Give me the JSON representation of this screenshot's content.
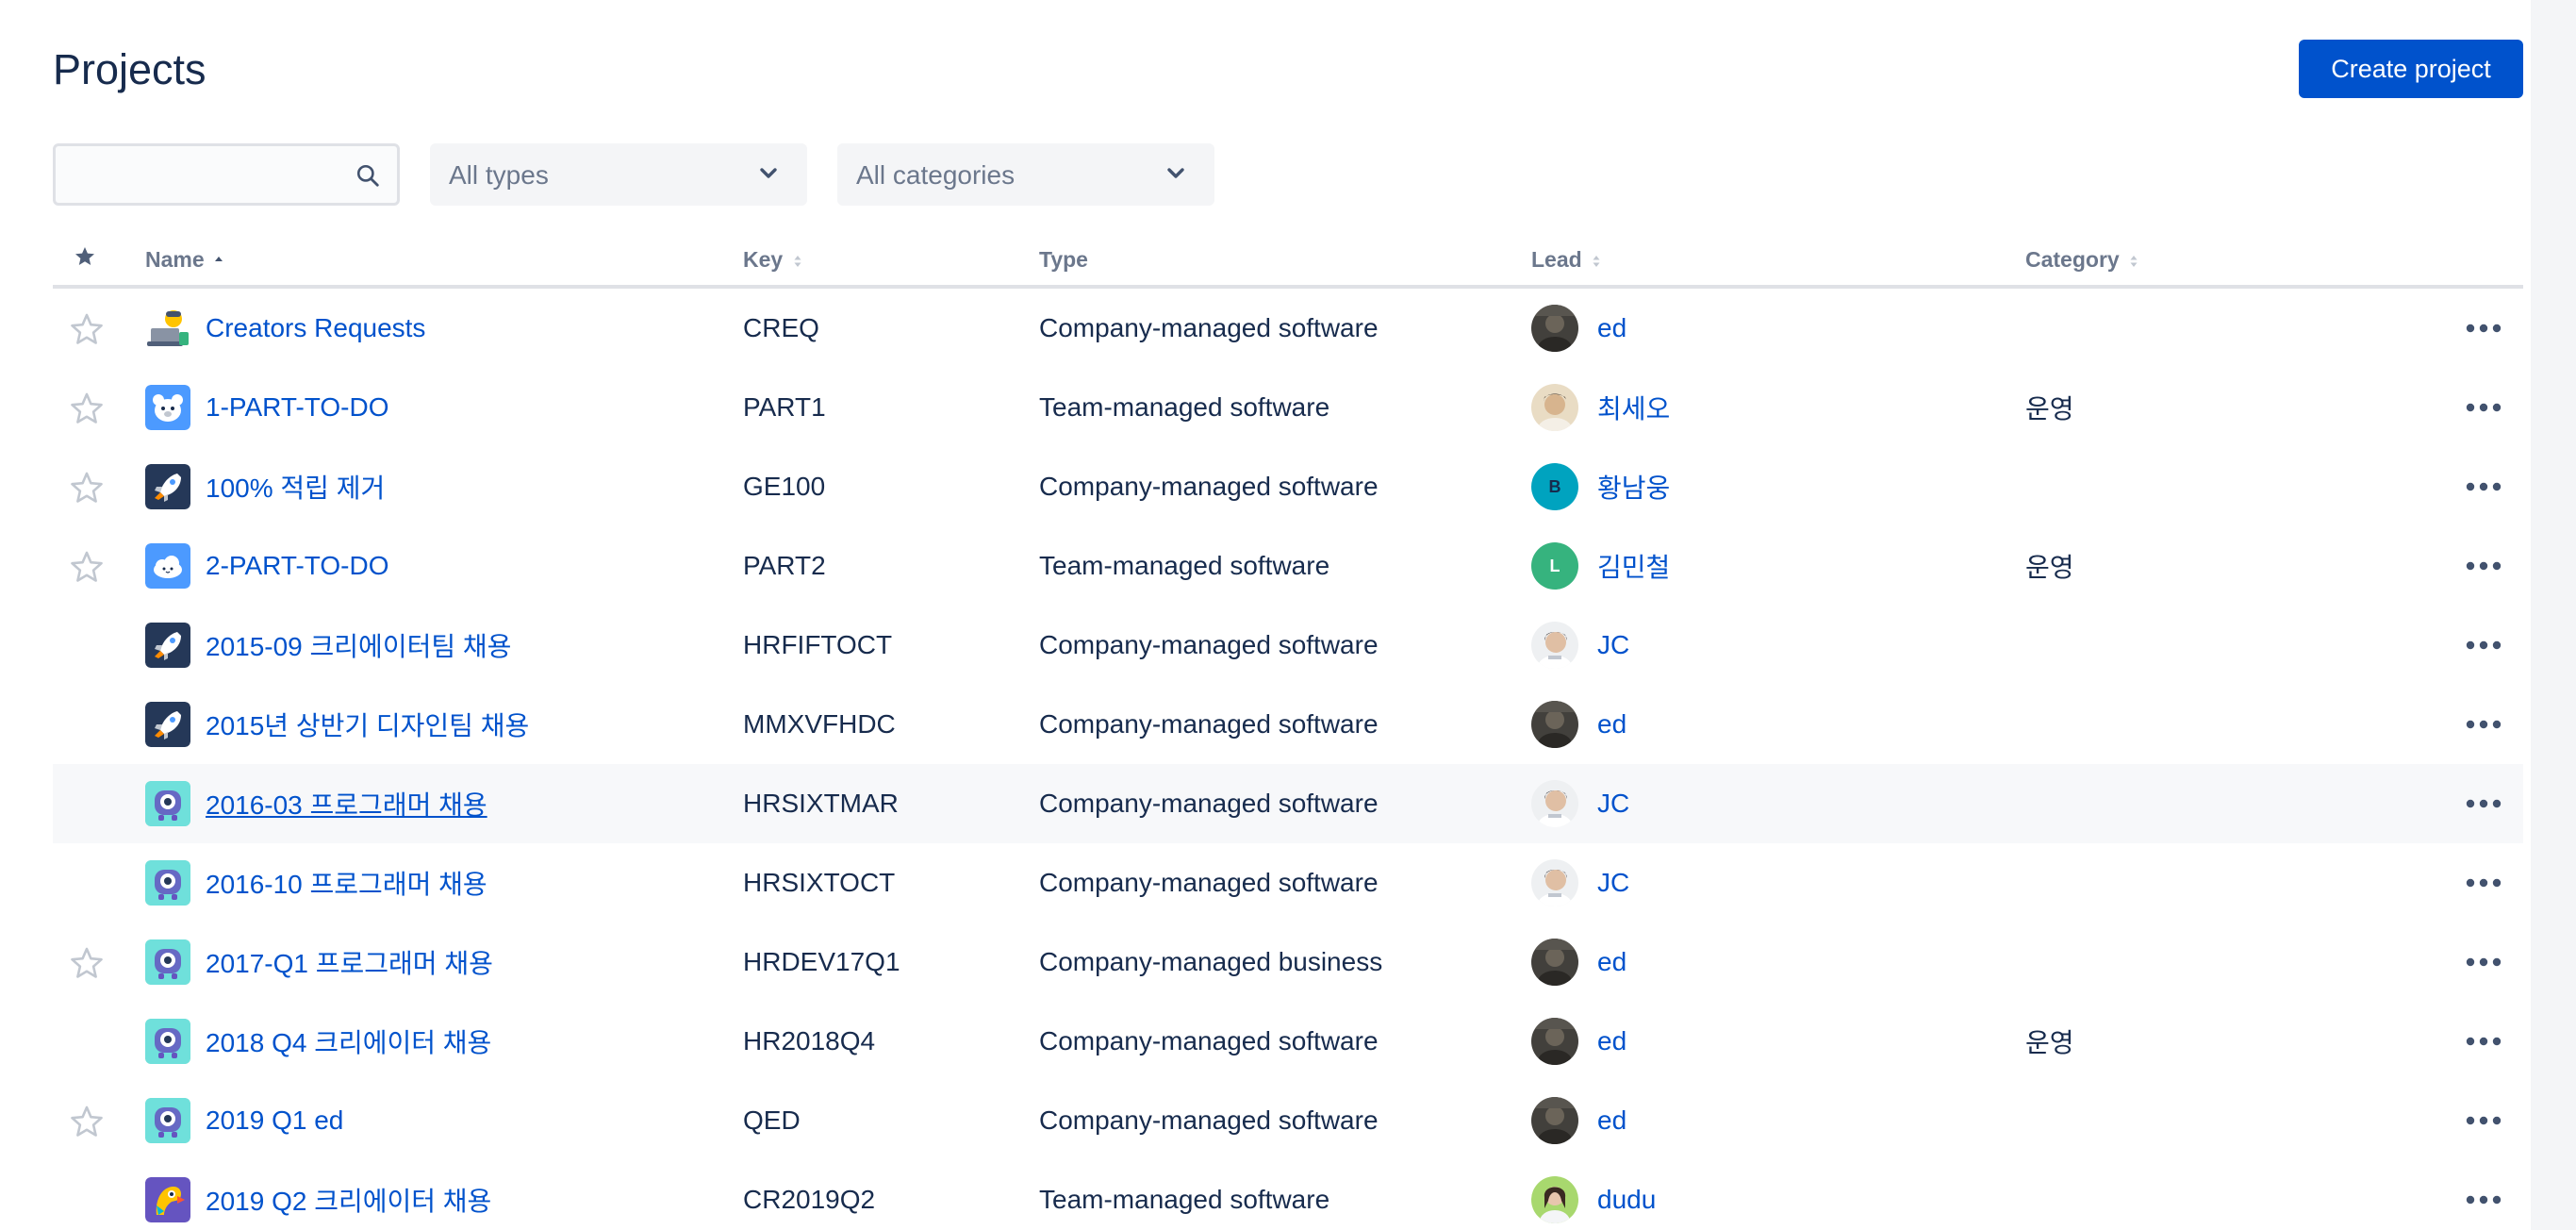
{
  "header": {
    "title": "Projects",
    "create_label": "Create project"
  },
  "filters": {
    "search_placeholder": "",
    "types_label": "All types",
    "categories_label": "All categories"
  },
  "columns": {
    "name": "Name",
    "key": "Key",
    "type": "Type",
    "lead": "Lead",
    "category": "Category"
  },
  "rows": [
    {
      "name": "Creators Requests",
      "key": "CREQ",
      "type": "Company-managed software",
      "lead": "ed",
      "category": "",
      "starred": false,
      "show_star": true,
      "icon": "laptop-icon",
      "avatar": "photo-dark"
    },
    {
      "name": "1-PART-TO-DO",
      "key": "PART1",
      "type": "Team-managed software",
      "lead": "최세오",
      "category": "운영",
      "starred": false,
      "show_star": true,
      "icon": "bear-icon",
      "avatar": "photo-light"
    },
    {
      "name": "100% 적립 제거",
      "key": "GE100",
      "type": "Company-managed software",
      "lead": "황남웅",
      "category": "",
      "starred": false,
      "show_star": true,
      "icon": "rocket-icon",
      "avatar": "initial-b",
      "avatar_initial": "B"
    },
    {
      "name": "2-PART-TO-DO",
      "key": "PART2",
      "type": "Team-managed software",
      "lead": "김민철",
      "category": "운영",
      "starred": false,
      "show_star": true,
      "icon": "cloud-icon",
      "avatar": "initial-l",
      "avatar_initial": "L"
    },
    {
      "name": "2015-09 크리에이터팀 채용",
      "key": "HRFIFTOCT",
      "type": "Company-managed software",
      "lead": "JC",
      "category": "",
      "starred": false,
      "show_star": false,
      "icon": "rocket-icon",
      "avatar": "photo-jc"
    },
    {
      "name": "2015년 상반기 디자인팀 채용",
      "key": "MMXVFHDC",
      "type": "Company-managed software",
      "lead": "ed",
      "category": "",
      "starred": false,
      "show_star": false,
      "icon": "rocket-icon",
      "avatar": "photo-dark"
    },
    {
      "name": "2016-03 프로그래머 채용",
      "key": "HRSIXTMAR",
      "type": "Company-managed software",
      "lead": "JC",
      "category": "",
      "starred": false,
      "show_star": false,
      "icon": "robot-icon",
      "avatar": "photo-jc",
      "hover": true
    },
    {
      "name": "2016-10 프로그래머 채용",
      "key": "HRSIXTOCT",
      "type": "Company-managed software",
      "lead": "JC",
      "category": "",
      "starred": false,
      "show_star": false,
      "icon": "robot-icon",
      "avatar": "photo-jc"
    },
    {
      "name": "2017-Q1 프로그래머 채용",
      "key": "HRDEV17Q1",
      "type": "Company-managed business",
      "lead": "ed",
      "category": "",
      "starred": false,
      "show_star": true,
      "icon": "robot-icon",
      "avatar": "photo-dark"
    },
    {
      "name": "2018 Q4 크리에이터 채용",
      "key": "HR2018Q4",
      "type": "Company-managed software",
      "lead": "ed",
      "category": "운영",
      "starred": false,
      "show_star": false,
      "icon": "robot-icon",
      "avatar": "photo-dark"
    },
    {
      "name": "2019 Q1 ed",
      "key": "QED",
      "type": "Company-managed software",
      "lead": "ed",
      "category": "",
      "starred": false,
      "show_star": true,
      "icon": "robot-icon",
      "avatar": "photo-dark"
    },
    {
      "name": "2019 Q2 크리에이터 채용",
      "key": "CR2019Q2",
      "type": "Team-managed software",
      "lead": "dudu",
      "category": "",
      "starred": false,
      "show_star": false,
      "icon": "parrot-icon",
      "avatar": "photo-green"
    }
  ],
  "colors": {
    "accent": "#0052cc",
    "text": "#172b4d",
    "muted": "#6b778c"
  }
}
